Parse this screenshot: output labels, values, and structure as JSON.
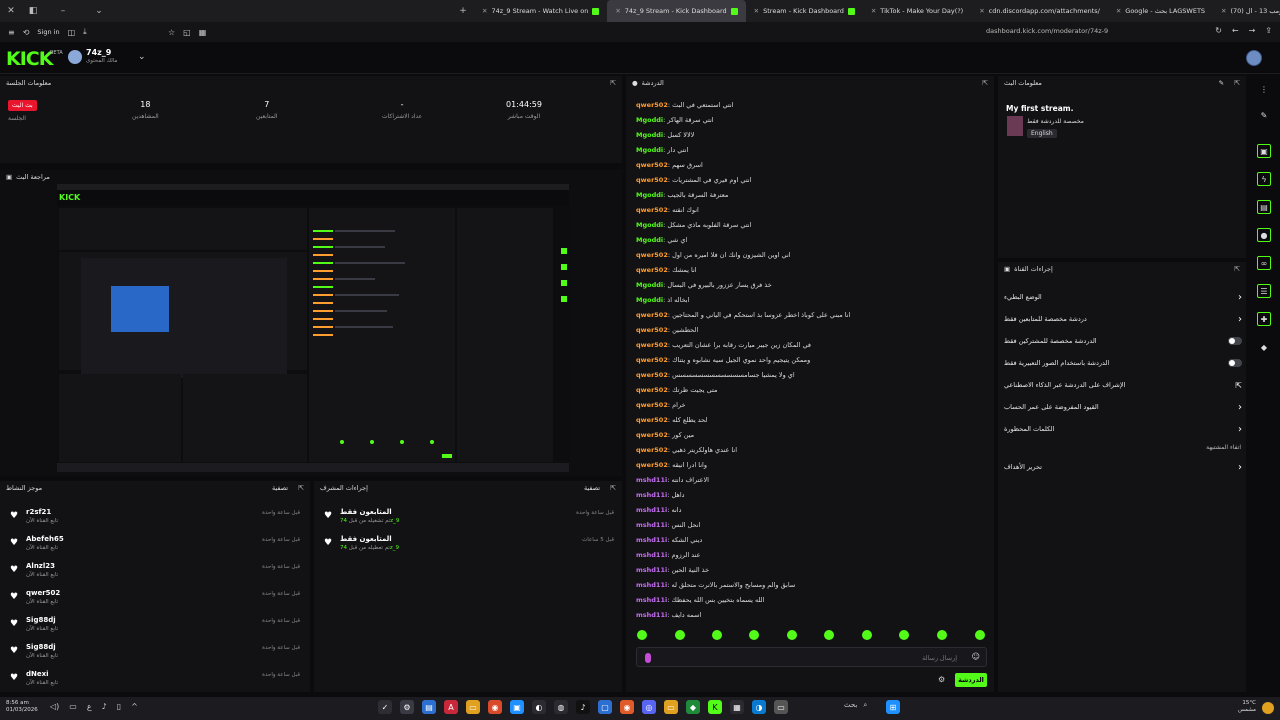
{
  "browser": {
    "tabs": [
      {
        "label": "74z_9 Stream - Watch Live on",
        "active": false
      },
      {
        "label": "74z_9 Stream - Kick Dashboard",
        "active": true
      },
      {
        "label": "Stream - Kick Dashboard",
        "active": false
      },
      {
        "label": "TikTok - Make Your Day(?)",
        "active": false
      },
      {
        "label": "cdn.discordapp.com/attachments/",
        "active": false
      },
      {
        "label": "Google - بحث LAGSWETS",
        "active": false
      },
      {
        "label": "(70) مسلسل شباب البومب 13 - ال",
        "active": false
      }
    ],
    "sign_in": "Sign in",
    "url": "dashboard.kick.com/moderator/74z-9"
  },
  "header": {
    "logo": "KICK",
    "beta": "BETA",
    "channel_name": "74z_9",
    "channel_sub": "مالك المحتوى"
  },
  "session_info": {
    "title": "معلومات الجلسة",
    "live_badge": "بث اليت",
    "live_label": "الجلسة",
    "stats": [
      {
        "value": "18",
        "label": "المشاهدين"
      },
      {
        "value": "7",
        "label": "المتابعين"
      },
      {
        "value": "-",
        "label": "عداد الاشتراكات"
      },
      {
        "value": "01:44:59",
        "label": "الوقت مباشر"
      }
    ]
  },
  "stream_preview": {
    "title": "مراجعة البث"
  },
  "activity_feed": {
    "title": "موجز النشاط",
    "filter_label": "تصفية",
    "items": [
      {
        "name": "r2sf21",
        "sub": "تابع القناة الآن",
        "time": "قبل ساعة واحدة"
      },
      {
        "name": "Abefeh65",
        "sub": "تابع القناة الآن",
        "time": "قبل ساعة واحدة"
      },
      {
        "name": "Alnzl23",
        "sub": "تابع القناة الآن",
        "time": "قبل ساعة واحدة"
      },
      {
        "name": "qwer502",
        "sub": "تابع القناة الآن",
        "time": "قبل ساعة واحدة"
      },
      {
        "name": "Sig88dj",
        "sub": "تابع القناة الآن",
        "time": "قبل ساعة واحدة"
      },
      {
        "name": "Sig88dj",
        "sub": "تابع القناة الآن",
        "time": "قبل ساعة واحدة"
      },
      {
        "name": "dNexi",
        "sub": "تابع القناة الآن",
        "time": "قبل ساعة واحدة"
      }
    ]
  },
  "mod_actions": {
    "title": "إجراءات المشرف",
    "filter_label": "تصفية",
    "items": [
      {
        "title": "المتابعون فقط",
        "by": "74z_9",
        "detail": "تم تشغيله من قبل",
        "time": "قبل ساعة واحدة"
      },
      {
        "title": "المتابعون فقط",
        "by": "74z_9",
        "detail": "تم تعطيله من قبل",
        "time": "قبل 5 ساعات"
      }
    ]
  },
  "chat": {
    "title": "الدردشة",
    "messages": [
      {
        "user": "qwer502",
        "color": "#ff9d2e",
        "text": "انتي استمتعي في البث"
      },
      {
        "user": "Mgoddi",
        "color": "#53fc18",
        "text": "انتي سرقة الهاكر"
      },
      {
        "user": "Mgoddi",
        "color": "#53fc18",
        "text": "لالالا كسل"
      },
      {
        "user": "Mgoddi",
        "color": "#53fc18",
        "text": "انتي دار"
      },
      {
        "user": "qwer502",
        "color": "#ff9d2e",
        "text": "اسرق سهم"
      },
      {
        "user": "qwer502",
        "color": "#ff9d2e",
        "text": "انتي اوم فيري في المشتريات"
      },
      {
        "user": "Mgoddi",
        "color": "#53fc18",
        "text": "معترفة السرقة بالجيب"
      },
      {
        "user": "qwer502",
        "color": "#ff9d2e",
        "text": "انوك انقته"
      },
      {
        "user": "Mgoddi",
        "color": "#53fc18",
        "text": "انتي سرقة الفلوبه ماذي مشكل"
      },
      {
        "user": "Mgoddi",
        "color": "#53fc18",
        "text": "اي شي"
      },
      {
        "user": "qwer502",
        "color": "#ff9d2e",
        "text": "اني اوين الشيزون وانك ان فلا اميره من اول"
      },
      {
        "user": "qwer502",
        "color": "#ff9d2e",
        "text": "انا يمشك"
      },
      {
        "user": "Mgoddi",
        "color": "#53fc18",
        "text": "خذ فرق يسار عززور بالبيرو في البسال"
      },
      {
        "user": "Mgoddi",
        "color": "#53fc18",
        "text": "ابخاله اذ"
      },
      {
        "user": "qwer502",
        "color": "#ff9d2e",
        "text": "انا مبني على كوباذ اخطر عزوسا بذ استحكم في الياني و المحتاجين"
      },
      {
        "user": "qwer502",
        "color": "#ff9d2e",
        "text": "الحطشين"
      },
      {
        "user": "qwer502",
        "color": "#ff9d2e",
        "text": "في المكان زين جيبر ميارت رقابه برا عشان التعريب"
      },
      {
        "user": "qwer502",
        "color": "#ff9d2e",
        "text": "وممكن يتيجيم واحد نموي الجيل سيه نشابوه و يتناك"
      },
      {
        "user": "qwer502",
        "color": "#ff9d2e",
        "text": "اي ولا يمشيا جسامسسسسسسسسسسسس"
      },
      {
        "user": "qwer502",
        "color": "#ff9d2e",
        "text": "متى يجيت ظرتك"
      },
      {
        "user": "qwer502",
        "color": "#ff9d2e",
        "text": "خرام"
      },
      {
        "user": "qwer502",
        "color": "#ff9d2e",
        "text": "لحد يطلع كله"
      },
      {
        "user": "qwer502",
        "color": "#ff9d2e",
        "text": "مين كور"
      },
      {
        "user": "qwer502",
        "color": "#ff9d2e",
        "text": "انا عندي هاولكريتر ذهبي"
      },
      {
        "user": "qwer502",
        "color": "#ff9d2e",
        "text": "وانا ادرا انيقه"
      },
      {
        "user": "mshd11i",
        "color": "#c46cf0",
        "text": "الاعتراف دانته"
      },
      {
        "user": "mshd11i",
        "color": "#c46cf0",
        "text": "داهل"
      },
      {
        "user": "mshd11i",
        "color": "#c46cf0",
        "text": "دانه"
      },
      {
        "user": "mshd11i",
        "color": "#c46cf0",
        "text": "انحل النس"
      },
      {
        "user": "mshd11i",
        "color": "#c46cf0",
        "text": "ديني الشكه"
      },
      {
        "user": "mshd11i",
        "color": "#c46cf0",
        "text": "عند الرزوم"
      },
      {
        "user": "mshd11i",
        "color": "#c46cf0",
        "text": "خذ النية الحين"
      },
      {
        "user": "mshd11i",
        "color": "#c46cf0",
        "text": "سابق والم ومسابح والاستمر بالانرت متحلق له"
      },
      {
        "user": "mshd11i",
        "color": "#c46cf0",
        "text": "الله يسماه بتخيين بس الله يحفظك"
      },
      {
        "user": "mshd11i",
        "color": "#c46cf0",
        "text": "اسمه دايف"
      }
    ],
    "input_placeholder": "إرسال رسالة",
    "send_label": "الدردشة"
  },
  "stream_info": {
    "title": "معلومات البث",
    "stream_title": "My first stream.",
    "category": "مخصصة للدردشة فقط",
    "language": "English"
  },
  "channel_actions": {
    "title": "إجراءات القناة",
    "items": [
      {
        "label": "الوضع البطيء",
        "control": "chevron"
      },
      {
        "label": "دردشة مخصصة للمتابعين فقط",
        "control": "chevron"
      },
      {
        "label": "الدردشة مخصصة للمشتركين فقط",
        "control": "toggle"
      },
      {
        "label": "الدردشة باستخدام الصور التعبيرية فقط",
        "control": "toggle"
      },
      {
        "label": "الإشراف على الدردشة عبر الذكاء الاصطناعي",
        "control": "external"
      },
      {
        "label": "القيود المفروضة على عمر الحساب",
        "control": "chevron"
      },
      {
        "label": "الكلمات المحظورة",
        "control": "chevron"
      }
    ],
    "section_label": "اتفاء المشتبهة",
    "extra_item": "تحرير الأهداف"
  },
  "taskbar": {
    "time": "8:56 am",
    "date": "01/03/2026",
    "search": "بحث",
    "temp": "15°C",
    "weather": "مشمس"
  },
  "colors": {
    "brand": "#53fc18",
    "live": "#e8152d"
  }
}
